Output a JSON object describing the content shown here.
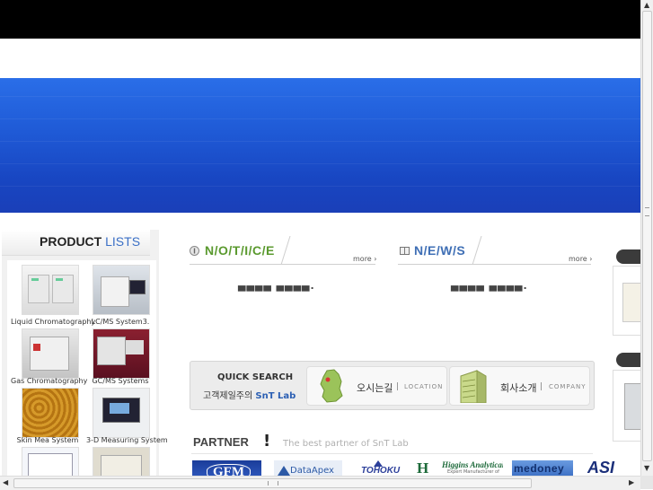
{
  "product_list": {
    "title_bold": "PRODUCT",
    "title_light": "LISTS",
    "items": [
      {
        "label": "Liquid Chromatography"
      },
      {
        "label": "LC/MS System3."
      },
      {
        "label": "Gas Chromatography"
      },
      {
        "label": "GC/MS Systems"
      },
      {
        "label": "Skin  Mea System"
      },
      {
        "label": "3-D Measuring System"
      }
    ]
  },
  "notice": {
    "title": "N/O/T/I/C/E",
    "more": "more ›",
    "content": "▄▄▄▄ ▄▄▄▄."
  },
  "news": {
    "title": "N/E/W/S",
    "more": "more ›",
    "content": "▄▄▄▄ ▄▄▄▄."
  },
  "quick_search": {
    "title": "QUICK SEARCH",
    "subtitle_prefix": "고객제일주의",
    "subtitle_brand": "SnT Lab",
    "location_label": "오시는길",
    "location_eng": "LOCATION",
    "company_label": "회사소개",
    "company_eng": "COMPANY"
  },
  "partner": {
    "title": "PARTNER",
    "subtitle": "The best partner of SnT Lab",
    "logos": [
      {
        "text": "GFM"
      },
      {
        "text": "DataApex"
      },
      {
        "text": "TOHOKU"
      },
      {
        "text": "Higgins Analytical"
      },
      {
        "text": "Expert Manufacturer of"
      },
      {
        "text": "medoney"
      },
      {
        "text": "ASI"
      }
    ]
  },
  "colors": {
    "banner_top": "#2a6ee8",
    "banner_bottom": "#1a3fb8",
    "notice_green": "#5b9a2f",
    "news_blue": "#3f6fb5",
    "brand_blue": "#2b5fb3"
  }
}
